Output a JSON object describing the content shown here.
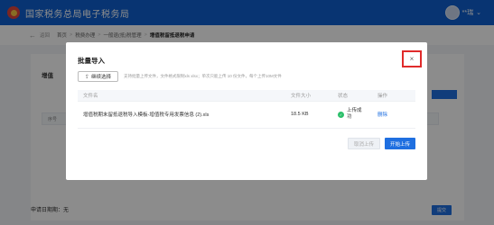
{
  "header": {
    "site_title": "国家税务总局电子税务局",
    "user_name": "**瑞"
  },
  "breadcrumb": {
    "back_label": "返回",
    "items": [
      "首页",
      "税费办理",
      "一般退(抵)税管理",
      "增值税留抵退税申请"
    ]
  },
  "modal": {
    "title": "批量导入",
    "continue_label": "继续选择",
    "hint": "支持批量上传文件，文件格式限制xls xlsx；单次只能上传 10 份文件，每个上传10M文件",
    "columns": [
      "文件名",
      "文件大小",
      "状态",
      "操作"
    ],
    "rows": [
      {
        "name": "增值税期末留抵退税导入模板-增值税专用发票信息 (2).xls",
        "size": "18.5 KB",
        "status": "上传成功",
        "action": "删除"
      }
    ],
    "cancel_label": "取消上传",
    "start_label": "开始上传"
  },
  "background": {
    "section_title": "增值",
    "table_head": "序号",
    "footer_label": "申请日期期：无",
    "footer_button": "提交"
  },
  "colors": {
    "primary": "#1f6fe0",
    "topbar": "#0f5fcf",
    "success": "#2cbf6a",
    "close_highlight": "#e02b2b"
  }
}
